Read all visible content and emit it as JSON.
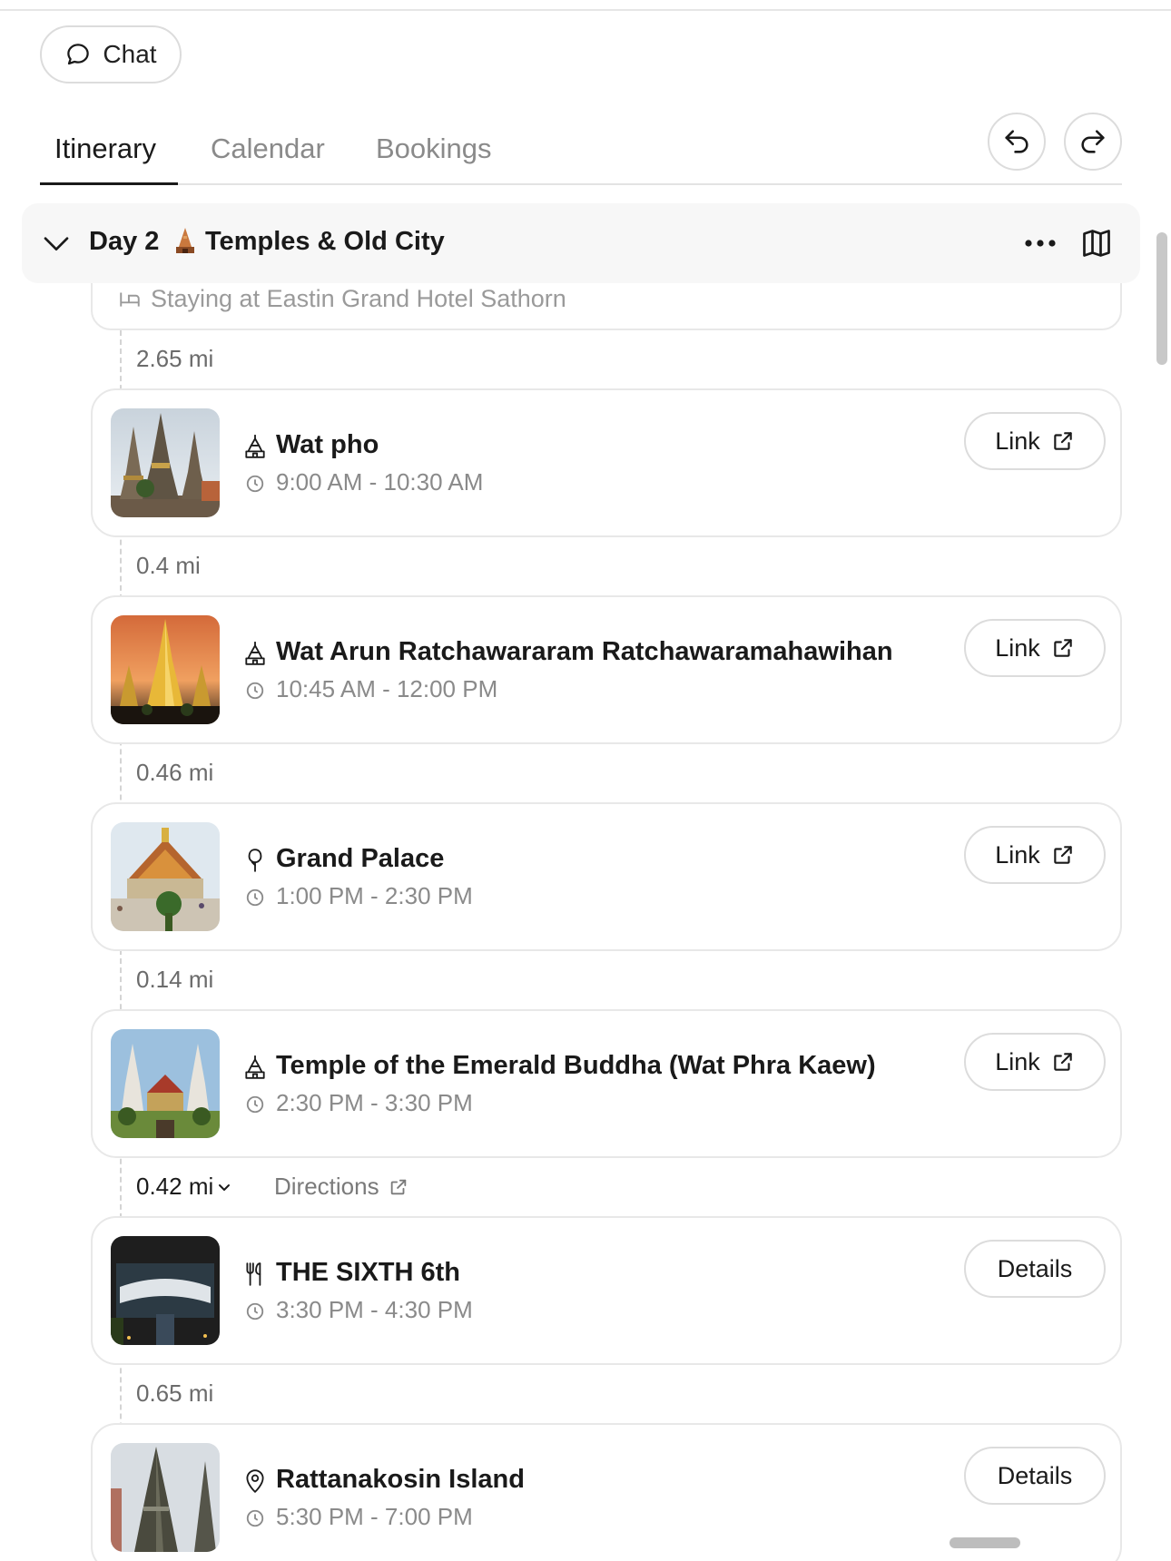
{
  "chat": {
    "label": "Chat",
    "icon": "chat-bubble-icon"
  },
  "tabs": [
    {
      "label": "Itinerary",
      "active": true
    },
    {
      "label": "Calendar",
      "active": false
    },
    {
      "label": "Bookings",
      "active": false
    }
  ],
  "toolbar": {
    "undo_icon": "undo-icon",
    "redo_icon": "redo-icon"
  },
  "day": {
    "label": "Day 2",
    "emoji": "temple-emoji",
    "title": "Temples & Old City",
    "more_icon": "more-dots-icon",
    "map_icon": "map-icon"
  },
  "stay": {
    "text": "Staying at Eastin Grand Hotel Sathorn",
    "icon": "bed-icon"
  },
  "distances": {
    "d0": "2.65 mi",
    "d1": "0.4 mi",
    "d2": "0.46 mi",
    "d3": "0.14 mi",
    "d4": "0.42 mi",
    "d5": "0.65 mi"
  },
  "directions_label": "Directions",
  "stops": [
    {
      "title": "Wat pho",
      "time": "9:00 AM  -  10:30 AM",
      "category_icon": "temple-icon",
      "action": "Link"
    },
    {
      "title": "Wat Arun Ratchawararam Ratchawaramahawihan",
      "time": "10:45 AM  -  12:00 PM",
      "category_icon": "temple-icon",
      "action": "Link"
    },
    {
      "title": "Grand Palace",
      "time": "1:00 PM  -  2:30 PM",
      "category_icon": "tree-icon",
      "action": "Link"
    },
    {
      "title": "Temple of the Emerald Buddha (Wat Phra Kaew)",
      "time": "2:30 PM  -  3:30 PM",
      "category_icon": "temple-icon",
      "action": "Link"
    },
    {
      "title": "THE SIXTH 6th",
      "time": "3:30 PM  -  4:30 PM",
      "category_icon": "fork-knife-icon",
      "action": "Details"
    },
    {
      "title": "Rattanakosin Island",
      "time": "5:30 PM  -  7:00 PM",
      "category_icon": "map-pin-icon",
      "action": "Details"
    }
  ],
  "colors": {
    "text": "#1a1a1a",
    "muted": "#8a8a8a",
    "border": "#e8e8e8",
    "header_bg": "#f7f7f7"
  }
}
